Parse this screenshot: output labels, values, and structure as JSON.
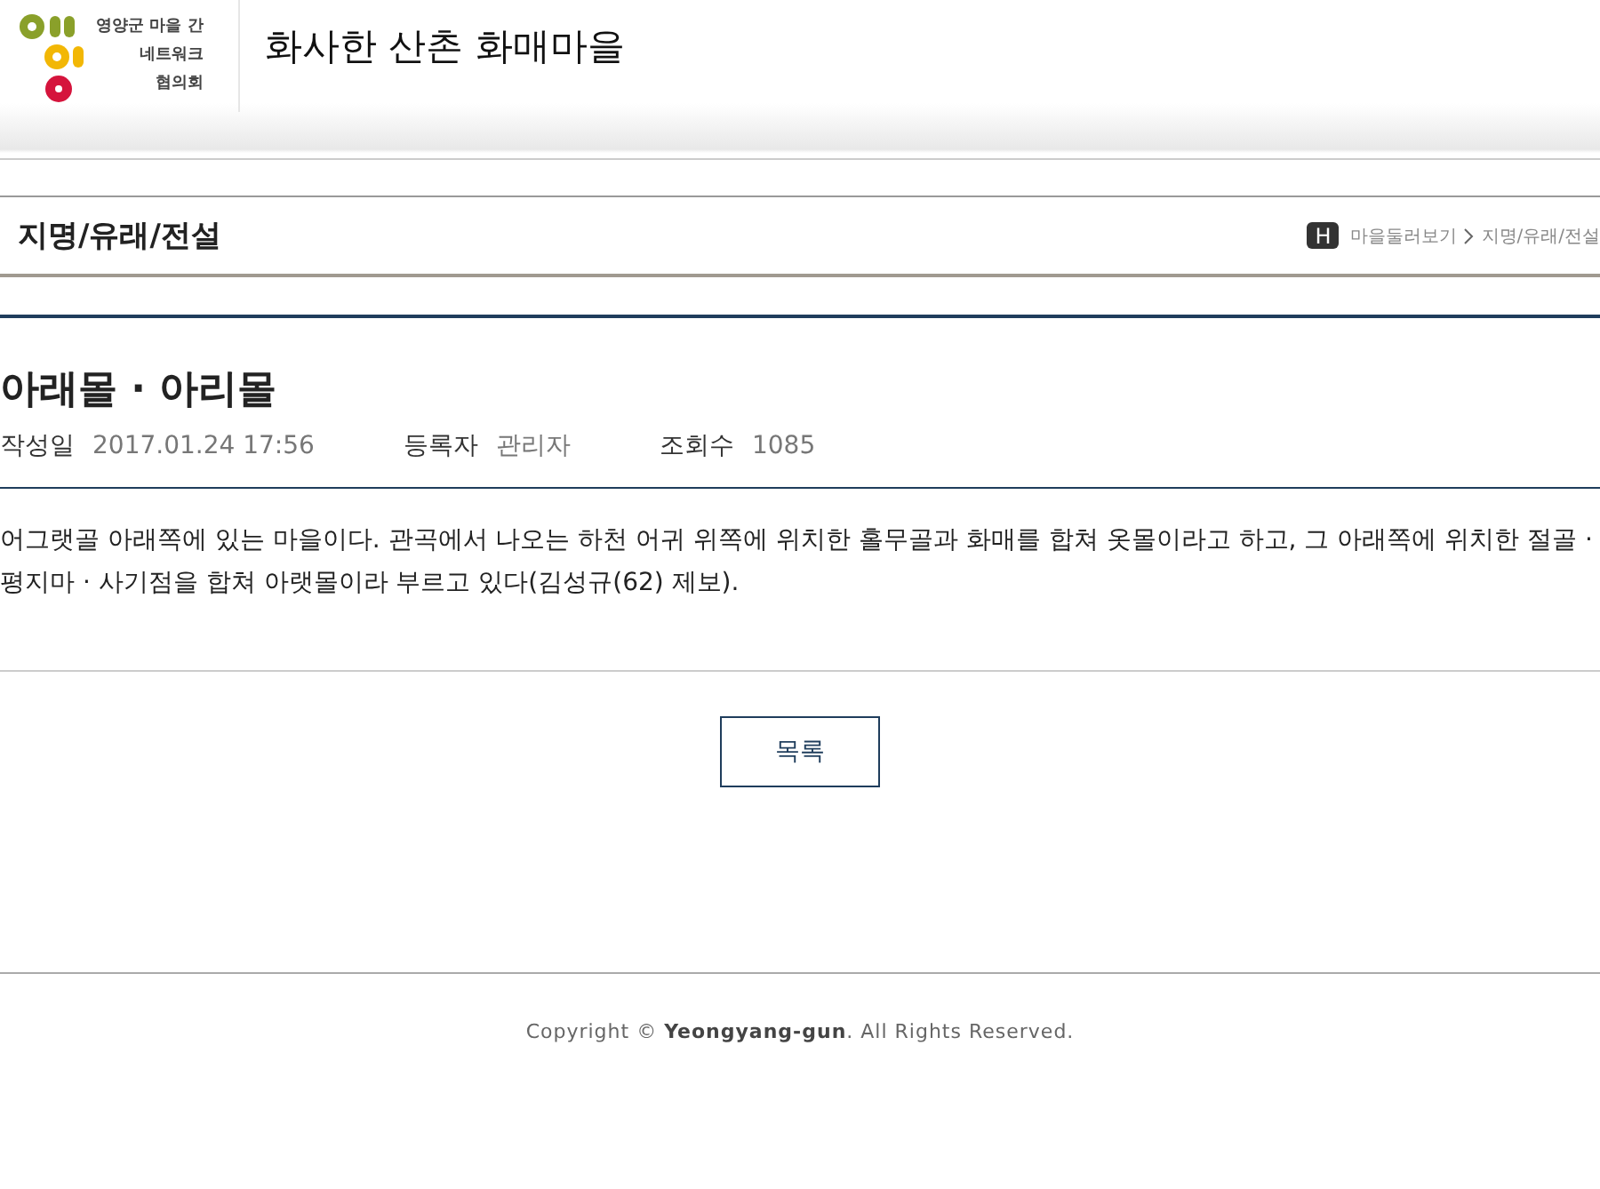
{
  "header": {
    "logo_lines": [
      "영양군 마을 간",
      "네트워크",
      "협의회"
    ],
    "site_title": "화사한 산촌 화매마을"
  },
  "page_heading": {
    "title": "지명/유래/전설",
    "breadcrumb_home": "H",
    "breadcrumb": [
      "마을둘러보기",
      "지명/유래/전설"
    ]
  },
  "article": {
    "title": "아래몰 · 아리몰",
    "meta": [
      {
        "label": "작성일",
        "value": "2017.01.24 17:56"
      },
      {
        "label": "등록자",
        "value": "관리자"
      },
      {
        "label": "조회수",
        "value": "1085"
      }
    ],
    "body": "어그랫골 아래쪽에 있는 마을이다. 관곡에서 나오는 하천 어귀 위쪽에 위치한 홀무골과 화매를 합쳐 옷몰이라고 하고, 그 아래쪽에 위치한 절골 · 평지마 · 사기점을 합쳐 아랫몰이라 부르고 있다(김성규(62) 제보)."
  },
  "list_button": "목록",
  "footer": "Copyright © **Yeongyang-gun**. All Rights Reserved."
}
